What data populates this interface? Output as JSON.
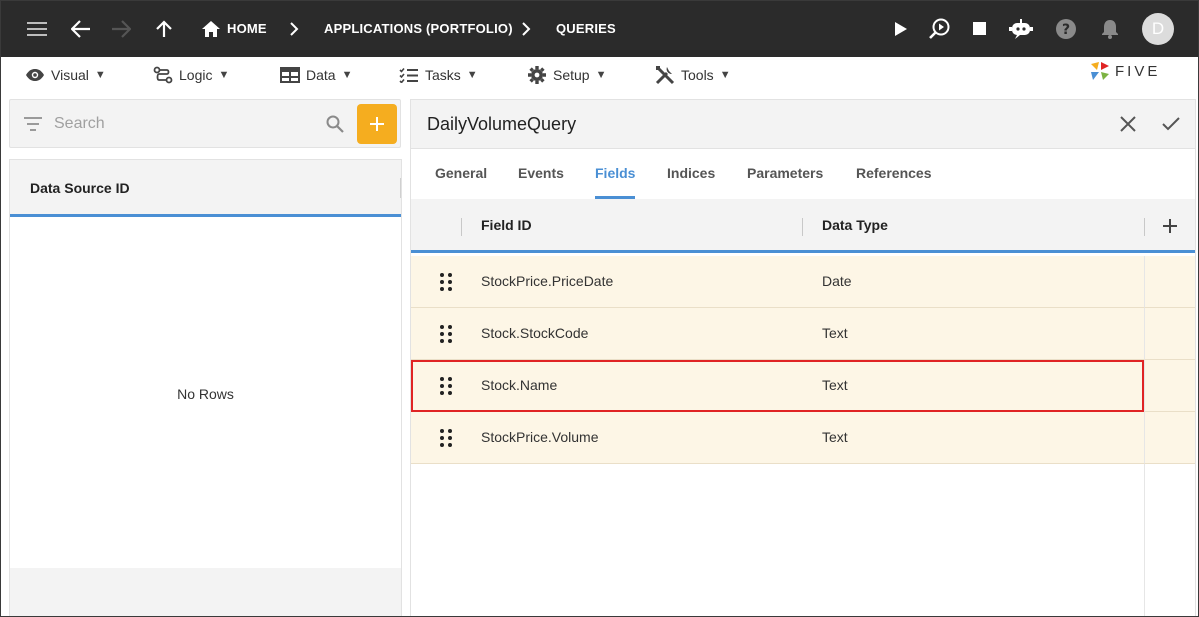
{
  "topbar": {
    "breadcrumb": [
      "HOME",
      "APPLICATIONS (PORTFOLIO)",
      "QUERIES"
    ],
    "avatar_letter": "D"
  },
  "menu": [
    {
      "label": "Visual",
      "icon": "eye-icon"
    },
    {
      "label": "Logic",
      "icon": "logic-flow-icon"
    },
    {
      "label": "Data",
      "icon": "table-icon"
    },
    {
      "label": "Tasks",
      "icon": "checklist-icon"
    },
    {
      "label": "Setup",
      "icon": "gear-icon"
    },
    {
      "label": "Tools",
      "icon": "tools-icon"
    }
  ],
  "logo": {
    "text": "FIVE"
  },
  "left": {
    "search_placeholder": "Search",
    "column_header": "Data Source ID",
    "empty_text": "No Rows"
  },
  "right": {
    "title": "DailyVolumeQuery",
    "tabs": [
      "General",
      "Events",
      "Fields",
      "Indices",
      "Parameters",
      "References"
    ],
    "active_tab": "Fields",
    "columns": [
      "Field ID",
      "Data Type"
    ],
    "rows": [
      {
        "field_id": "StockPrice.PriceDate",
        "data_type": "Date"
      },
      {
        "field_id": "Stock.StockCode",
        "data_type": "Text"
      },
      {
        "field_id": "Stock.Name",
        "data_type": "Text",
        "highlighted": true
      },
      {
        "field_id": "StockPrice.Volume",
        "data_type": "Text"
      }
    ]
  },
  "colors": {
    "topbar_bg": "#2b2b2b",
    "accent_blue": "#4a8fd4",
    "add_button": "#f5ad1f",
    "row_bg": "#fdf6e6",
    "highlight_border": "#e02424"
  }
}
